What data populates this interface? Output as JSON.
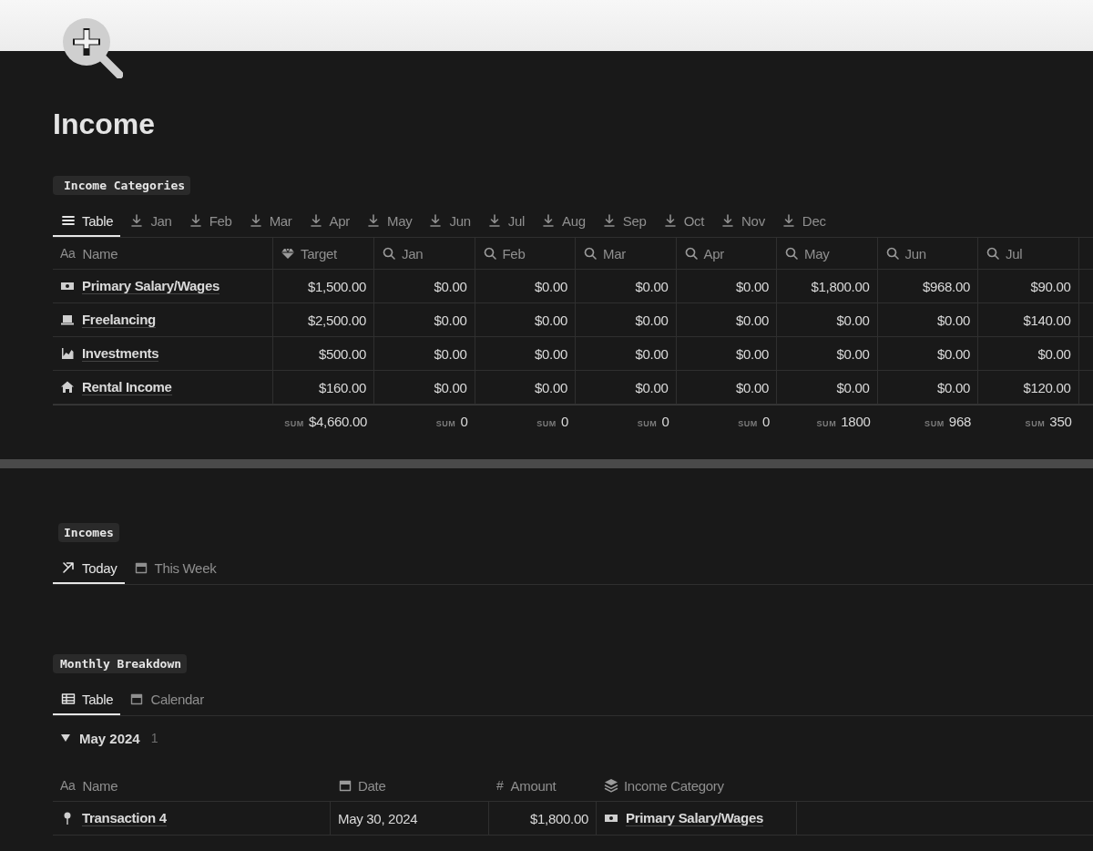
{
  "page": {
    "title": "Income"
  },
  "categories": {
    "label": "Income Categories",
    "views": [
      {
        "label": "Table",
        "kind": "list",
        "selected": true
      },
      {
        "label": "Jan",
        "kind": "download",
        "selected": false
      },
      {
        "label": "Feb",
        "kind": "download",
        "selected": false
      },
      {
        "label": "Mar",
        "kind": "download",
        "selected": false
      },
      {
        "label": "Apr",
        "kind": "download",
        "selected": false
      },
      {
        "label": "May",
        "kind": "download",
        "selected": false
      },
      {
        "label": "Jun",
        "kind": "download",
        "selected": false
      },
      {
        "label": "Jul",
        "kind": "download",
        "selected": false
      },
      {
        "label": "Aug",
        "kind": "download",
        "selected": false
      },
      {
        "label": "Sep",
        "kind": "download",
        "selected": false
      },
      {
        "label": "Oct",
        "kind": "download",
        "selected": false
      },
      {
        "label": "Nov",
        "kind": "download",
        "selected": false
      },
      {
        "label": "Dec",
        "kind": "download",
        "selected": false
      }
    ],
    "table": {
      "columns": [
        {
          "label": "Name",
          "glyph": "Aa"
        },
        {
          "label": "Target",
          "kind": "diamond"
        },
        {
          "label": "Jan",
          "kind": "search"
        },
        {
          "label": "Feb",
          "kind": "search"
        },
        {
          "label": "Mar",
          "kind": "search"
        },
        {
          "label": "Apr",
          "kind": "search"
        },
        {
          "label": "May",
          "kind": "search"
        },
        {
          "label": "Jun",
          "kind": "search"
        },
        {
          "label": "Jul",
          "kind": "search"
        }
      ],
      "rows": [
        {
          "kind": "money",
          "name": "Primary Salary/Wages",
          "cells": [
            "$1,500.00",
            "$0.00",
            "$0.00",
            "$0.00",
            "$0.00",
            "$1,800.00",
            "$968.00",
            "$90.00"
          ]
        },
        {
          "kind": "laptop",
          "name": "Freelancing",
          "cells": [
            "$2,500.00",
            "$0.00",
            "$0.00",
            "$0.00",
            "$0.00",
            "$0.00",
            "$0.00",
            "$140.00"
          ]
        },
        {
          "kind": "chart",
          "name": "Investments",
          "cells": [
            "$500.00",
            "$0.00",
            "$0.00",
            "$0.00",
            "$0.00",
            "$0.00",
            "$0.00",
            "$0.00"
          ]
        },
        {
          "kind": "house",
          "name": "Rental Income",
          "cells": [
            "$160.00",
            "$0.00",
            "$0.00",
            "$0.00",
            "$0.00",
            "$0.00",
            "$0.00",
            "$120.00"
          ]
        }
      ],
      "sums": [
        {
          "label": "SUM",
          "value": "$4,660.00"
        },
        {
          "label": "SUM",
          "value": "0"
        },
        {
          "label": "SUM",
          "value": "0"
        },
        {
          "label": "SUM",
          "value": "0"
        },
        {
          "label": "SUM",
          "value": "0"
        },
        {
          "label": "SUM",
          "value": "1800"
        },
        {
          "label": "SUM",
          "value": "968"
        },
        {
          "label": "SUM",
          "value": "350"
        }
      ]
    }
  },
  "incomes": {
    "label": "Incomes",
    "views": [
      {
        "label": "Today",
        "kind": "arrow",
        "selected": true
      },
      {
        "label": "This Week",
        "kind": "calendar",
        "selected": false
      }
    ]
  },
  "breakdown": {
    "label": "Monthly Breakdown",
    "views": [
      {
        "label": "Table",
        "kind": "grid",
        "selected": true
      },
      {
        "label": "Calendar",
        "kind": "calendar",
        "selected": false
      }
    ],
    "group": {
      "label": "May 2024",
      "count": "1",
      "expanded": true
    },
    "table": {
      "columns": [
        {
          "label": "Name",
          "glyph": "Aa"
        },
        {
          "label": "Date",
          "kind": "calendar"
        },
        {
          "label": "Amount",
          "glyph": "#"
        },
        {
          "label": "Income Category",
          "kind": "layers"
        }
      ],
      "rows": [
        {
          "kind": "pin",
          "name": "Transaction 4",
          "date": "May 30, 2024",
          "amount": "$1,800.00",
          "category": {
            "kind": "money",
            "label": "Primary Salary/Wages"
          }
        }
      ]
    }
  }
}
